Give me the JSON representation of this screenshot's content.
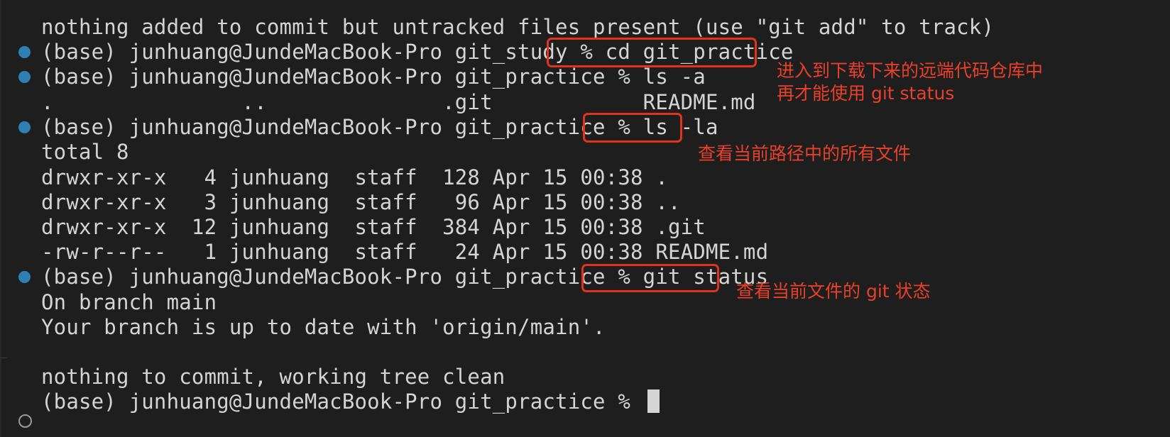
{
  "terminal": {
    "lines": [
      "nothing added to commit but untracked files present (use \"git add\" to track)",
      "(base) junhuang@JundeMacBook-Pro git_study % cd git_practice",
      "(base) junhuang@JundeMacBook-Pro git_practice % ls -a",
      ".               ..              .git            README.md",
      "(base) junhuang@JundeMacBook-Pro git_practice % ls -la",
      "total 8",
      "drwxr-xr-x   4 junhuang  staff  128 Apr 15 00:38 .",
      "drwxr-xr-x   3 junhuang  staff   96 Apr 15 00:38 ..",
      "drwxr-xr-x  12 junhuang  staff  384 Apr 15 00:38 .git",
      "-rw-r--r--   1 junhuang  staff   24 Apr 15 00:38 README.md",
      "(base) junhuang@JundeMacBook-Pro git_practice % git status",
      "On branch main",
      "Your branch is up to date with 'origin/main'.",
      "",
      "nothing to commit, working tree clean",
      "(base) junhuang@JundeMacBook-Pro git_practice % "
    ]
  },
  "annotations": {
    "cd_note_line1": "进入到下载下来的远端代码仓库中",
    "cd_note_line2": "再才能使用 git status",
    "ls_note": "查看当前路径中的所有文件",
    "status_note": "查看当前文件的 git 状态"
  },
  "colors": {
    "background": "#1e1e1e",
    "text": "#d4d4d4",
    "prompt_dot": "#2f7fb3",
    "highlight": "#e0341e"
  }
}
